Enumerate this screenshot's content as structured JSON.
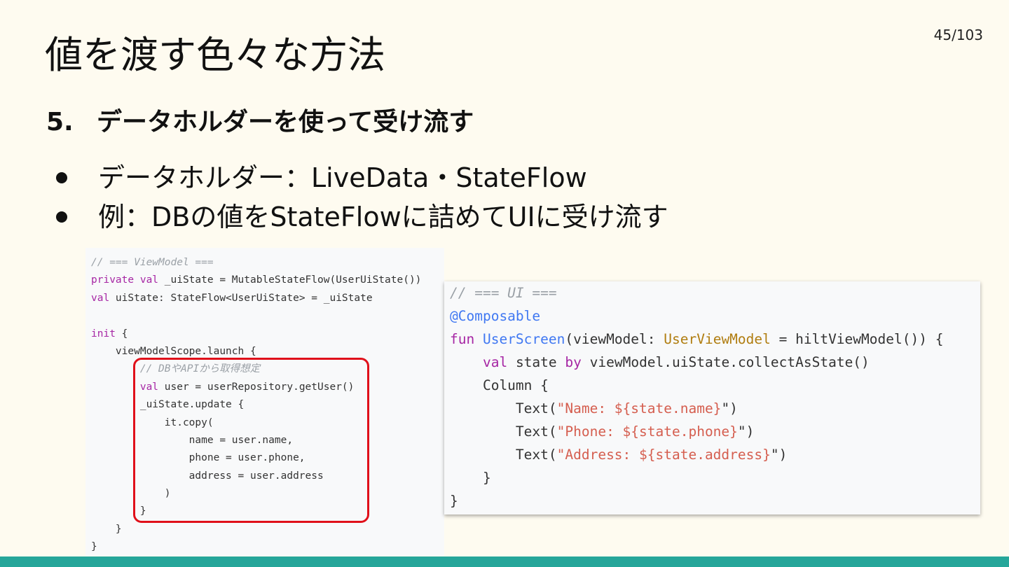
{
  "slide": {
    "title": "値を渡す色々な方法",
    "page_number": "45/103",
    "subtitle_number": "5.",
    "subtitle": "データホルダーを使って受け流す",
    "bullets": [
      "データホルダー：LiveData・StateFlow",
      "例：DBの値をStateFlowに詰めてUIに受け流す"
    ],
    "colors": {
      "background": "#fefbf0",
      "footer_bar": "#26a69a",
      "highlight_border": "#e0101a"
    }
  },
  "code_left": {
    "lines": [
      [
        {
          "t": "// === ViewModel ===",
          "c": "cmt"
        }
      ],
      [
        {
          "t": "private val ",
          "c": "kw"
        },
        {
          "t": "_uiState = MutableStateFlow(UserUiState())",
          "c": ""
        }
      ],
      [
        {
          "t": "val ",
          "c": "kw"
        },
        {
          "t": "uiState: StateFlow<UserUiState> = _uiState",
          "c": ""
        }
      ],
      [
        {
          "t": "",
          "c": ""
        }
      ],
      [
        {
          "t": "init",
          "c": "kw"
        },
        {
          "t": " {",
          "c": ""
        }
      ],
      [
        {
          "t": "    viewModelScope.launch {",
          "c": ""
        }
      ],
      [
        {
          "t": "        ",
          "c": ""
        },
        {
          "t": "// DBやAPIから取得想定",
          "c": "cmt"
        }
      ],
      [
        {
          "t": "        ",
          "c": ""
        },
        {
          "t": "val ",
          "c": "kw"
        },
        {
          "t": "user = userRepository.getUser()",
          "c": ""
        }
      ],
      [
        {
          "t": "        _uiState.update {",
          "c": ""
        }
      ],
      [
        {
          "t": "            it.copy(",
          "c": ""
        }
      ],
      [
        {
          "t": "                name = user.name,",
          "c": ""
        }
      ],
      [
        {
          "t": "                phone = user.phone,",
          "c": ""
        }
      ],
      [
        {
          "t": "                address = user.address",
          "c": ""
        }
      ],
      [
        {
          "t": "            )",
          "c": ""
        }
      ],
      [
        {
          "t": "        }",
          "c": ""
        }
      ],
      [
        {
          "t": "    }",
          "c": ""
        }
      ],
      [
        {
          "t": "}",
          "c": ""
        }
      ]
    ]
  },
  "code_right": {
    "lines": [
      [
        {
          "t": "// === UI ===",
          "c": "cmt"
        }
      ],
      [
        {
          "t": "@Composable",
          "c": "ann"
        }
      ],
      [
        {
          "t": "fun ",
          "c": "kw"
        },
        {
          "t": "UserScreen",
          "c": "fn"
        },
        {
          "t": "(viewModel: ",
          "c": ""
        },
        {
          "t": "UserViewModel",
          "c": "type"
        },
        {
          "t": " = hiltViewModel()) {",
          "c": ""
        }
      ],
      [
        {
          "t": "    ",
          "c": ""
        },
        {
          "t": "val ",
          "c": "kw"
        },
        {
          "t": "state ",
          "c": ""
        },
        {
          "t": "by ",
          "c": "kw"
        },
        {
          "t": "viewModel.uiState.collectAsState()",
          "c": ""
        }
      ],
      [
        {
          "t": "    Column {",
          "c": ""
        }
      ],
      [
        {
          "t": "        Text(",
          "c": ""
        },
        {
          "t": "\"Name: ${state.name}",
          "c": "str"
        },
        {
          "t": "\")",
          "c": ""
        }
      ],
      [
        {
          "t": "        Text(",
          "c": ""
        },
        {
          "t": "\"Phone: ${state.phone}",
          "c": "str"
        },
        {
          "t": "\")",
          "c": ""
        }
      ],
      [
        {
          "t": "        Text(",
          "c": ""
        },
        {
          "t": "\"Address: ${state.address}",
          "c": "str"
        },
        {
          "t": "\")",
          "c": ""
        }
      ],
      [
        {
          "t": "    }",
          "c": ""
        }
      ],
      [
        {
          "t": "}",
          "c": ""
        }
      ]
    ]
  }
}
